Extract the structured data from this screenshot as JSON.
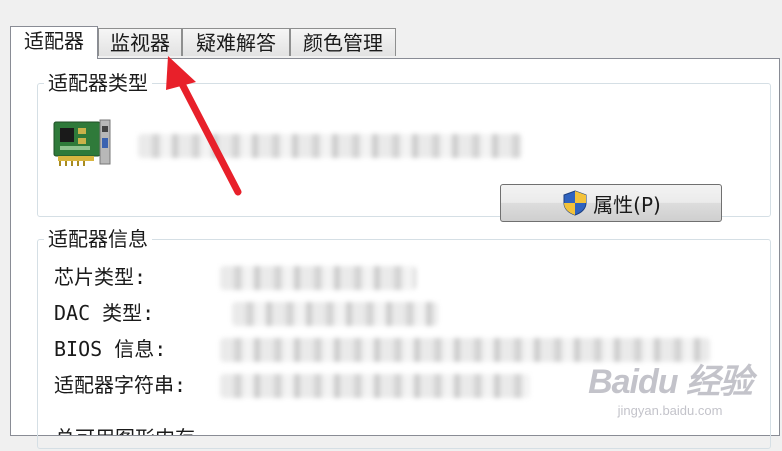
{
  "tabs": [
    {
      "label": "适配器",
      "active": true
    },
    {
      "label": "监视器",
      "active": false
    },
    {
      "label": "疑难解答",
      "active": false
    },
    {
      "label": "颜色管理",
      "active": false
    }
  ],
  "adapter_type": {
    "legend": "适配器类型",
    "icon": "graphics-card-icon",
    "properties_button": "属性(P)",
    "properties_icon": "uac-shield-icon"
  },
  "adapter_info": {
    "legend": "适配器信息",
    "rows": [
      {
        "label": "芯片类型:"
      },
      {
        "label": "DAC 类型:"
      },
      {
        "label": "BIOS 信息:"
      },
      {
        "label": "适配器字符串:"
      }
    ],
    "cut_off_text": "总可用图形内存"
  },
  "watermark": {
    "logo": "Baidu 经验",
    "url": "jingyan.baidu.com"
  },
  "colors": {
    "arrow": "#e8202a",
    "tab_border": "#898c95"
  }
}
